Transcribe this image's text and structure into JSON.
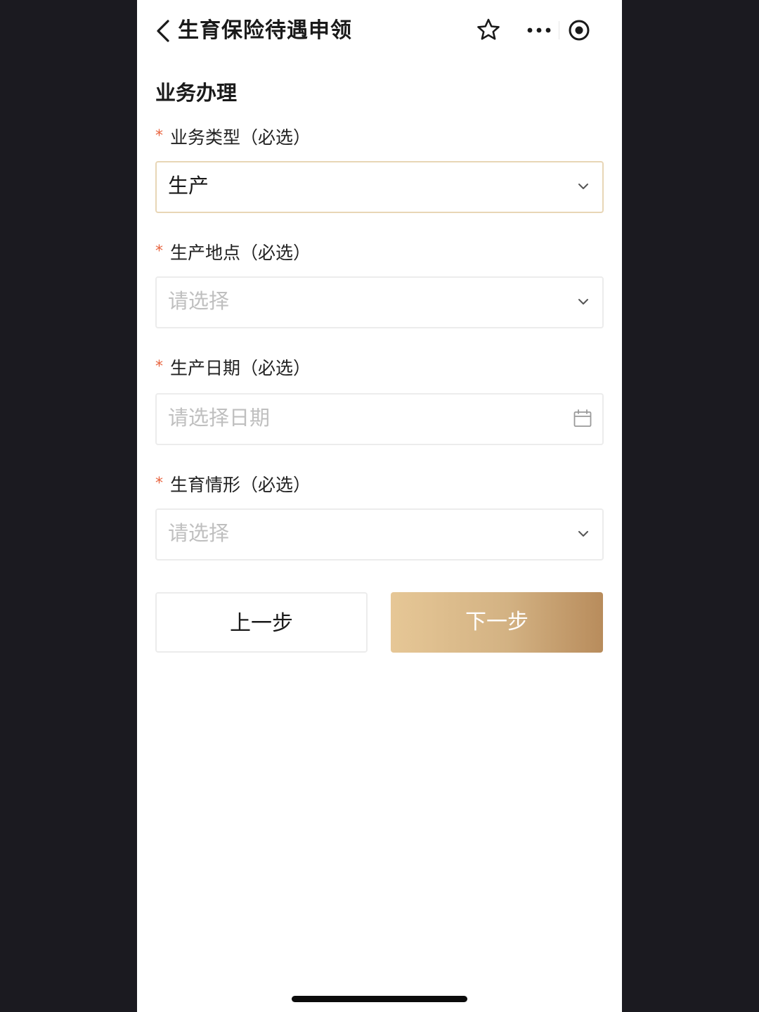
{
  "nav": {
    "title": "生育保险待遇申领",
    "icons": [
      "back-icon",
      "star-icon",
      "more-icon",
      "target-icon"
    ]
  },
  "section": {
    "title": "业务办理"
  },
  "fields": [
    {
      "required_mark": "*",
      "label": "业务类型（必选）",
      "value": "生产",
      "placeholder": "",
      "icon": "chevron-down-icon"
    },
    {
      "required_mark": "*",
      "label": "生产地点（必选）",
      "value": "",
      "placeholder": "请选择",
      "icon": "chevron-down-icon"
    },
    {
      "required_mark": "*",
      "label": "生产日期（必选）",
      "value": "",
      "placeholder": "请选择日期",
      "icon": "calendar-icon"
    },
    {
      "required_mark": "*",
      "label": "生育情形（必选）",
      "value": "",
      "placeholder": "请选择",
      "icon": "chevron-down-icon"
    }
  ],
  "buttons": {
    "prev": "上一步",
    "next": "下一步"
  },
  "colors": {
    "background": "#1b1a20",
    "required": "#e8643f",
    "accent_gradient_start": "#e6c796",
    "accent_gradient_end": "#b88c5c",
    "placeholder": "#bfbfbf"
  }
}
